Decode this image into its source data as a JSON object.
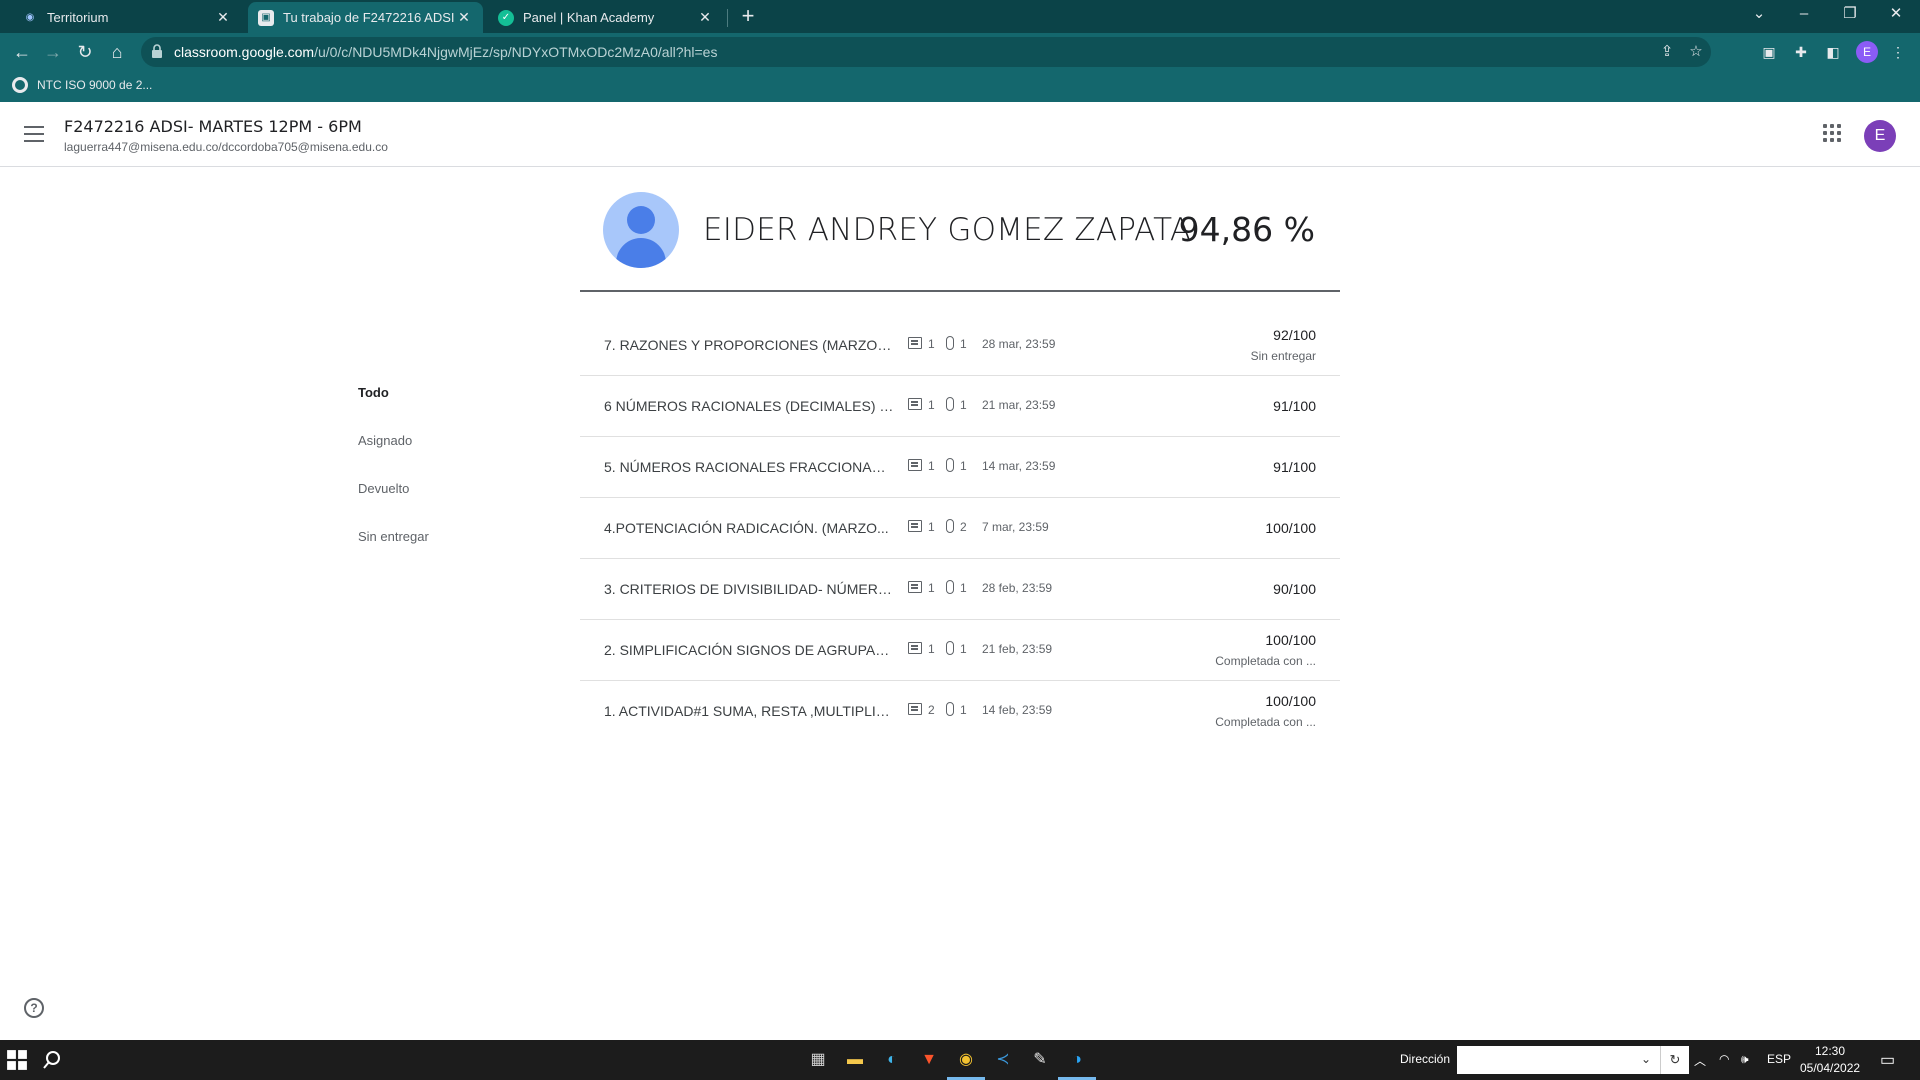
{
  "browser": {
    "tabs": [
      {
        "title": "Territorium",
        "active": false
      },
      {
        "title": "Tu trabajo de F2472216 ADSI- M",
        "active": true
      },
      {
        "title": "Panel | Khan Academy",
        "active": false
      }
    ],
    "new_tab": "+",
    "url_host": "classroom.google.com",
    "url_path": "/u/0/c/NDU5MDk4NjgwMjEz/sp/NDYxOTMxODc2MzA0/all?hl=es",
    "profile_initial": "E",
    "bookmarks": [
      {
        "label": "NTC ISO 9000 de 2..."
      }
    ]
  },
  "header": {
    "class_title": "F2472216 ADSI- MARTES 12PM - 6PM",
    "class_subtitle": "laguerra447@misena.edu.co/dccordoba705@misena.edu.co",
    "account_initial": "E"
  },
  "filters": [
    {
      "label": "Todo",
      "active": true
    },
    {
      "label": "Asignado",
      "active": false
    },
    {
      "label": "Devuelto",
      "active": false
    },
    {
      "label": "Sin entregar",
      "active": false
    }
  ],
  "student": {
    "name": "EIDER ANDREY GOMEZ ZAPATA",
    "overall_grade": "94,86 %"
  },
  "assignments": [
    {
      "title": "7. RAZONES Y PROPORCIONES (MARZO 2...",
      "comments": "1",
      "attachments": "1",
      "due": "28 mar, 23:59",
      "score": "92/100",
      "status": "Sin entregar"
    },
    {
      "title": "6 NÚMEROS RACIONALES (DECIMALES) 1...",
      "comments": "1",
      "attachments": "1",
      "due": "21 mar, 23:59",
      "score": "91/100",
      "status": ""
    },
    {
      "title": "5. NÚMEROS RACIONALES FRACCIONARI...",
      "comments": "1",
      "attachments": "1",
      "due": "14 mar, 23:59",
      "score": "91/100",
      "status": ""
    },
    {
      "title": "4.POTENCIACIÓN RADICACIÓN. (MARZO...",
      "comments": "1",
      "attachments": "2",
      "due": "7 mar, 23:59",
      "score": "100/100",
      "status": ""
    },
    {
      "title": "3. CRITERIOS DE DIVISIBILIDAD- NÚMERO...",
      "comments": "1",
      "attachments": "1",
      "due": "28 feb, 23:59",
      "score": "90/100",
      "status": ""
    },
    {
      "title": "2. SIMPLIFICACIÓN SIGNOS DE AGRUPAC...",
      "comments": "1",
      "attachments": "1",
      "due": "21 feb, 23:59",
      "score": "100/100",
      "status": "Completada con ..."
    },
    {
      "title": "1. ACTIVIDAD#1 SUMA, RESTA ,MULTIPLIC...",
      "comments": "2",
      "attachments": "1",
      "due": "14 feb, 23:59",
      "score": "100/100",
      "status": "Completada con ..."
    }
  ],
  "help": "?",
  "taskbar": {
    "address_label": "Dirección",
    "language": "ESP",
    "time": "12:30",
    "date": "05/04/2022"
  },
  "colors": {
    "tabstrip": "#0b4348",
    "toolbar": "#14676d",
    "avatar_purple": "#7b3fb8",
    "student_avatar_bg": "#a8c7fa",
    "student_avatar_fg": "#4a7ee8"
  }
}
